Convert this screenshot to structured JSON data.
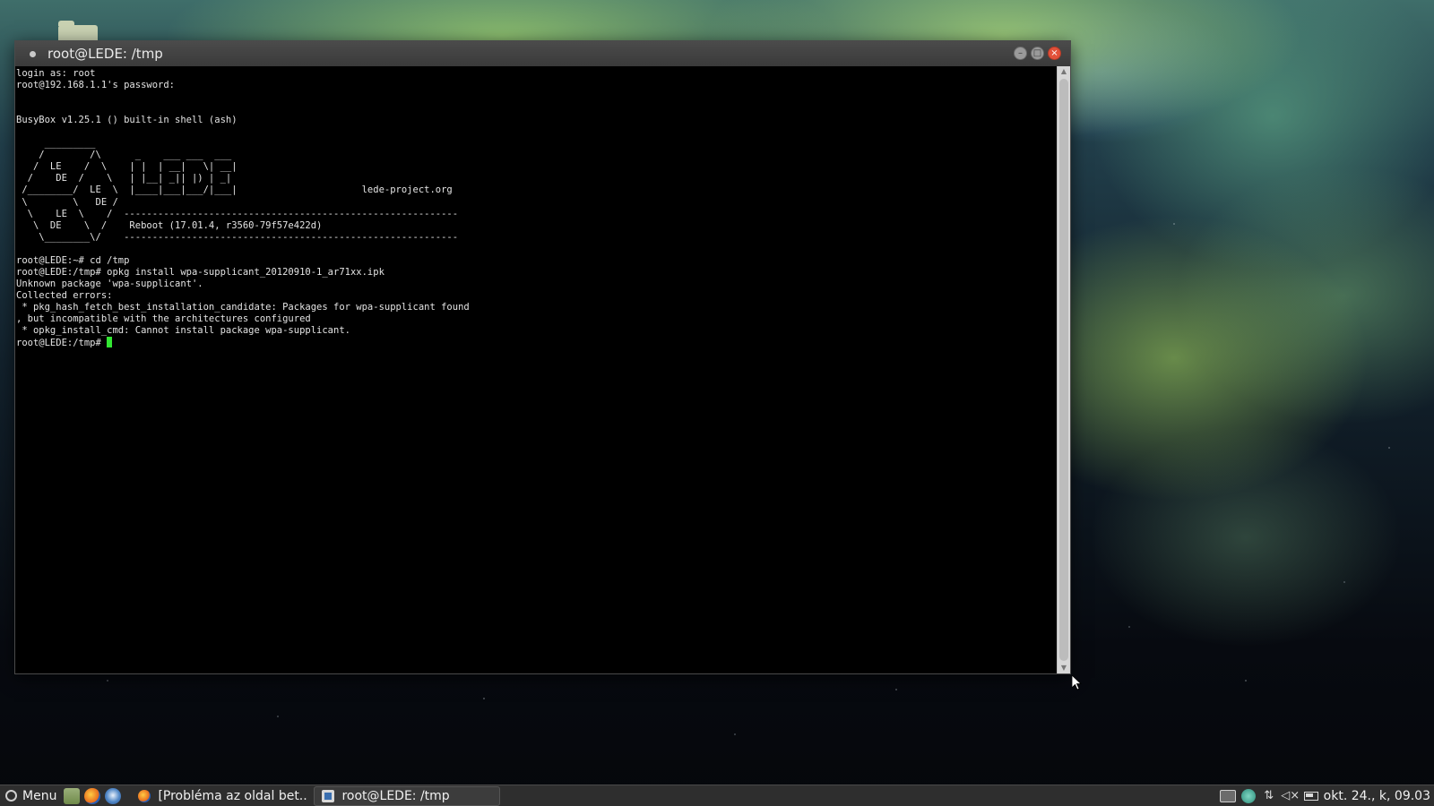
{
  "window": {
    "title": "root@LEDE: /tmp",
    "controls": {
      "minimize": "–",
      "maximize": "□",
      "close": "×"
    }
  },
  "terminal": {
    "output": "login as: root\nroot@192.168.1.1's password:\n\n\nBusyBox v1.25.1 () built-in shell (ash)\n\n     _________\n    /        /\\      _    ___ ___  ___\n   /  LE    /  \\    | |  | __|   \\| __|\n  /    DE  /    \\   | |__| _|| |) | _|\n /________/  LE  \\  |____|___|___/|___|                      lede-project.org\n \\        \\   DE /\n  \\    LE  \\    /  -----------------------------------------------------------\n   \\  DE    \\  /    Reboot (17.01.4, r3560-79f57e422d)\n    \\________\\/    -----------------------------------------------------------\n\nroot@LEDE:~# cd /tmp\nroot@LEDE:/tmp# opkg install wpa-supplicant_20120910-1_ar71xx.ipk\nUnknown package 'wpa-supplicant'.\nCollected errors:\n * pkg_hash_fetch_best_installation_candidate: Packages for wpa-supplicant found\n, but incompatible with the architectures configured\n * opkg_install_cmd: Cannot install package wpa-supplicant.",
    "prompt": "root@LEDE:/tmp# ",
    "cursor_color": "#32e632"
  },
  "taskbar": {
    "menu_label": "Menu",
    "launchers": [
      "files-icon",
      "firefox-icon",
      "thunderbird-icon"
    ],
    "tasks": [
      {
        "label": "[Probléma az oldal bet...",
        "icon": "firefox-icon"
      },
      {
        "label": "root@LEDE: /tmp",
        "icon": "terminal-icon"
      }
    ],
    "tray": {
      "network_label": "⇅",
      "volume_label": "◁×",
      "clock": "okt. 24., k, 09.03"
    }
  }
}
